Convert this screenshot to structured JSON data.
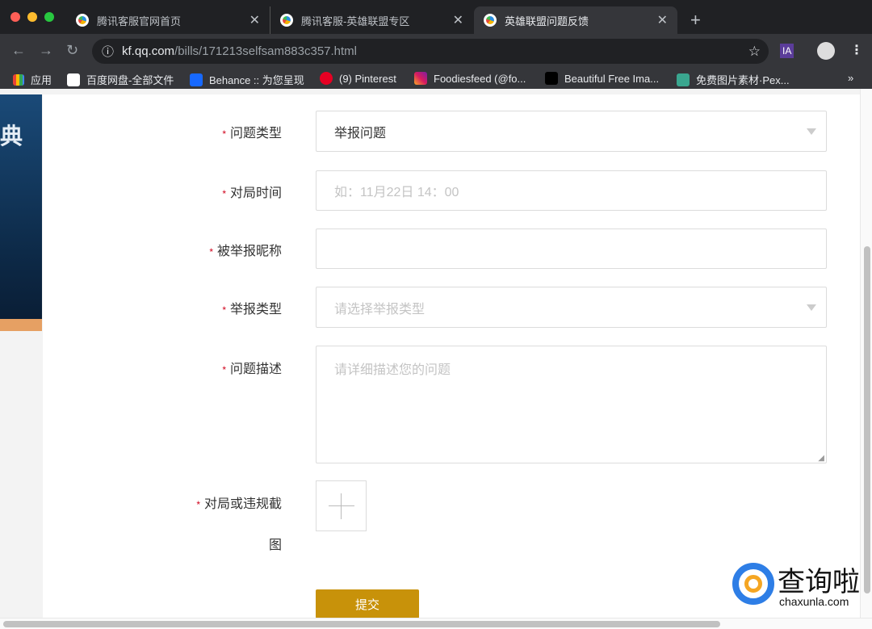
{
  "browser": {
    "tabs": [
      {
        "title": "腾讯客服官网首页"
      },
      {
        "title": "腾讯客服-英雄联盟专区"
      },
      {
        "title": "英雄联盟问题反馈",
        "active": true
      }
    ],
    "url_host": "kf.qq.com",
    "url_path": "/bills/171213selfsam883c357.html",
    "extension_label": "IA",
    "bookmarks": [
      "应用",
      "百度网盘-全部文件",
      "Behance :: 为您呈现",
      "(9) Pinterest",
      "Foodiesfeed (@fo...",
      "Beautiful Free Ima...",
      "免费图片素材·Pex..."
    ],
    "bookmarks_more": "»"
  },
  "banner": {
    "glyph": "典"
  },
  "form": {
    "required_mark": "*",
    "fields": [
      {
        "label": "问题类型",
        "value": "举报问题",
        "type": "select"
      },
      {
        "label": "对局时间",
        "placeholder": "如：11月22日 14：00",
        "type": "input"
      },
      {
        "label": "被举报昵称",
        "value": "",
        "type": "input"
      },
      {
        "label": "举报类型",
        "placeholder": "请选择举报类型",
        "type": "select"
      },
      {
        "label": "问题描述",
        "placeholder": "请详细描述您的问题",
        "type": "textarea"
      }
    ],
    "upload_label_line1": "对局或违规截",
    "upload_label_line2": "图",
    "submit": "提交"
  },
  "watermark": {
    "cn": "查询啦",
    "en": "chaxunla.com"
  }
}
